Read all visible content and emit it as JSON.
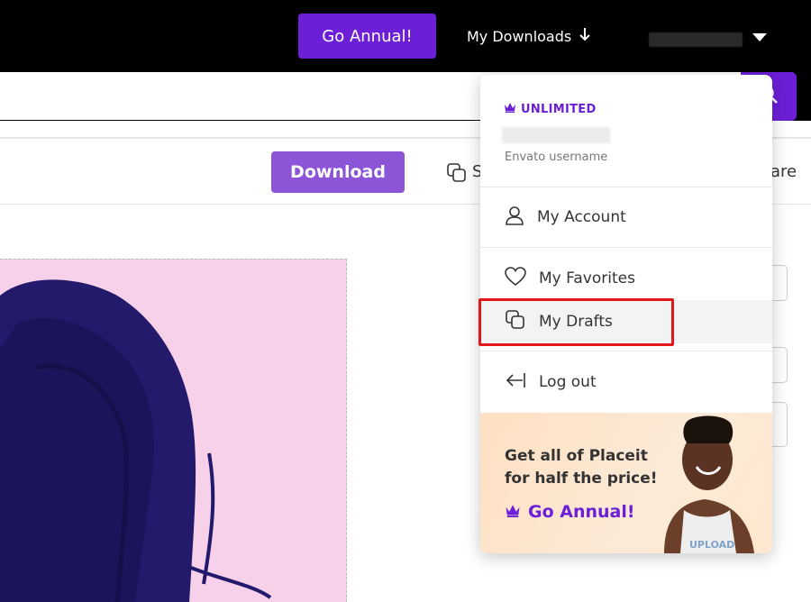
{
  "header": {
    "go_annual_label": "Go Annual!",
    "downloads_label": "My Downloads",
    "downloads_icon": "arrow-down-icon"
  },
  "toolbar": {
    "download_label": "Download",
    "copy_label_partial": "S",
    "share_label_partial": "are"
  },
  "dropdown": {
    "plan_label": "UNLIMITED",
    "username_caption": "Envato username",
    "items": [
      {
        "label": "My Account",
        "icon": "user-icon"
      },
      {
        "label": "My Favorites",
        "icon": "heart-icon"
      },
      {
        "label": "My Drafts",
        "icon": "drafts-icon"
      },
      {
        "label": "Log out",
        "icon": "logout-icon"
      }
    ],
    "promo": {
      "text": "Get all of Placeit for half the price!",
      "cta": "Go Annual!",
      "shirt_text": "UPLOAD"
    }
  },
  "colors": {
    "brand_purple": "#6c1fd6",
    "download_purple": "#8c54d6",
    "highlight_red": "#e0181b",
    "preview_pink": "#f7d0ea",
    "hoodie_navy": "#231a6b"
  }
}
